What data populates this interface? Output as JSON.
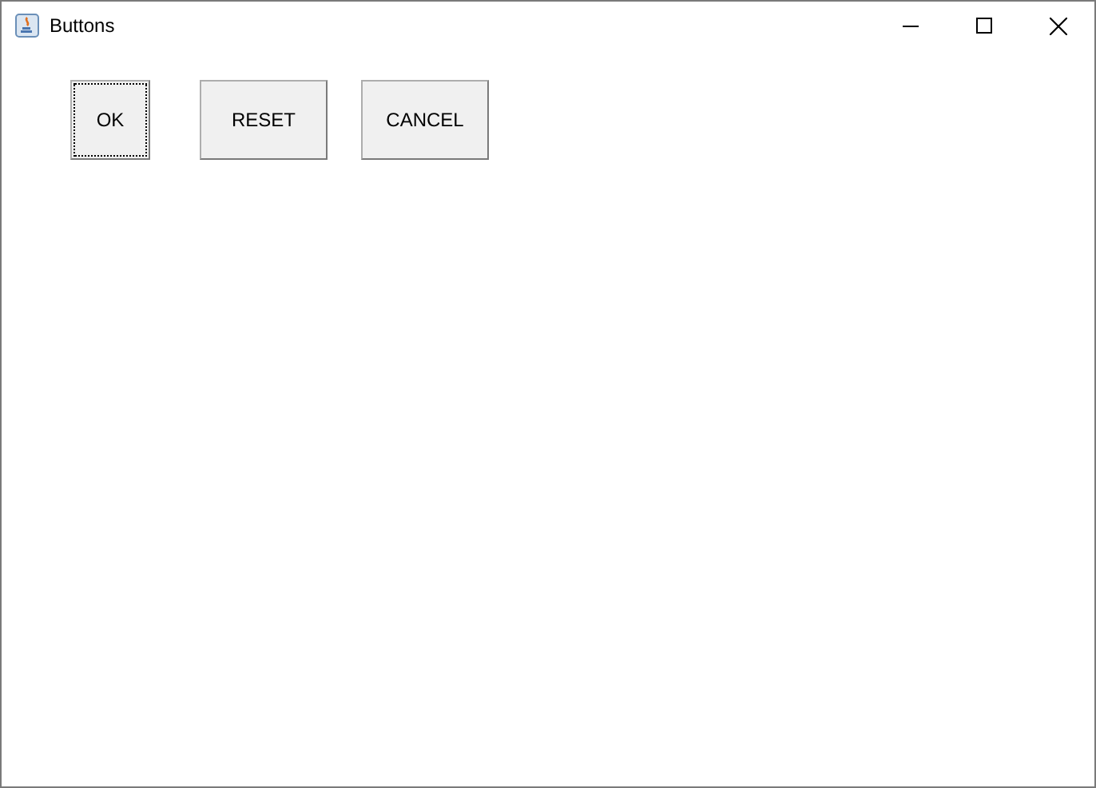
{
  "window": {
    "title": "Buttons"
  },
  "buttons": [
    {
      "label": "OK",
      "focused": true
    },
    {
      "label": "RESET",
      "focused": false
    },
    {
      "label": "CANCEL",
      "focused": false
    }
  ]
}
